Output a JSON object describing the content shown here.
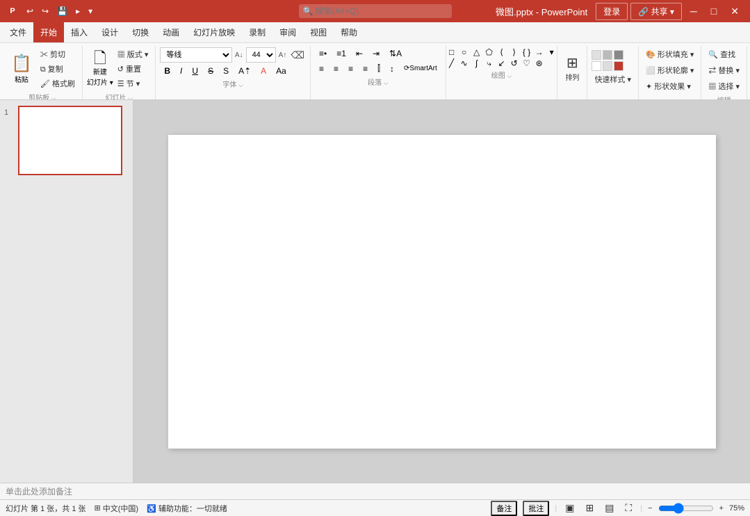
{
  "titleBar": {
    "filename": "微图.pptx - PowerPoint",
    "searchPlaceholder": "搜索(Alt+Q)",
    "loginLabel": "登录",
    "shareLabel": "🔗 共享 ▾",
    "quickAccess": [
      "↩",
      "↪",
      "💾",
      "▸",
      "▾"
    ]
  },
  "menuBar": {
    "items": [
      "文件",
      "开始",
      "插入",
      "设计",
      "切换",
      "动画",
      "幻灯片放映",
      "录制",
      "审阅",
      "视图",
      "帮助"
    ]
  },
  "ribbon": {
    "groups": [
      {
        "label": "剪贴板",
        "buttons": [
          {
            "id": "paste",
            "icon": "📋",
            "label": "粘贴"
          },
          {
            "id": "cut",
            "icon": "✂",
            "label": "剪切"
          },
          {
            "id": "copy",
            "icon": "⧉",
            "label": "复制"
          },
          {
            "id": "formatpaint",
            "icon": "🖌",
            "label": "格式刷"
          }
        ]
      },
      {
        "label": "幻灯片",
        "buttons": [
          {
            "id": "new-slide",
            "icon": "＋",
            "label": "新建\n幻灯片"
          },
          {
            "id": "layout",
            "icon": "▦",
            "label": "版式"
          },
          {
            "id": "reset",
            "icon": "↺",
            "label": "重置"
          },
          {
            "id": "section",
            "icon": "☰",
            "label": "节"
          }
        ]
      },
      {
        "label": "字体",
        "fontName": "等线",
        "fontSize": "44",
        "formatButtons": [
          "B",
          "I",
          "U",
          "S",
          "A",
          "A",
          "Aa",
          "A↑",
          "A↓",
          "A+",
          "A-"
        ]
      },
      {
        "label": "段落",
        "buttons": [
          "≡",
          "≡",
          "≡",
          "≡",
          "≡",
          "⊞",
          "⊟",
          "↵",
          "⇥",
          "⊙"
        ]
      },
      {
        "label": "绘图",
        "shapeRows": [
          [
            "□",
            "○",
            "△",
            "⬠",
            "⟨",
            "⟩",
            "{ }",
            "→"
          ],
          [
            "↗",
            "⋆",
            "☁",
            "⊕",
            "➔",
            "✎",
            "♡",
            "→"
          ]
        ]
      },
      {
        "label": "排列",
        "buttons": [
          "排列"
        ]
      },
      {
        "label": "快速样式",
        "buttons": [
          "快速样式"
        ]
      },
      {
        "label": "形状填充",
        "buttons": [
          "形状填充 ▾",
          "形状轮廓 ▾",
          "形状效果 ▾"
        ]
      },
      {
        "label": "编辑",
        "buttons": [
          "查找",
          "替换 ▾",
          "选择 ▾"
        ]
      }
    ]
  },
  "slides": [
    {
      "num": "1",
      "isEmpty": true
    }
  ],
  "canvas": {
    "slideWidth": "788",
    "slideHeight": "451"
  },
  "notes": {
    "placeholder": "单击此处添加备注"
  },
  "statusBar": {
    "slideInfo": "幻灯片 第 1 张，共 1 张",
    "langIcon": "⊞",
    "language": "中文(中国)",
    "accessibility": "♿ 辅助功能：一切就绪",
    "commentBtn": "备注",
    "notesBtn": "批注",
    "viewNormal": "▣",
    "viewSlideSort": "⊞",
    "viewReading": "▤",
    "viewPresent": "⛶",
    "zoomLevel": "75%",
    "zoomIcon": "🔍"
  }
}
